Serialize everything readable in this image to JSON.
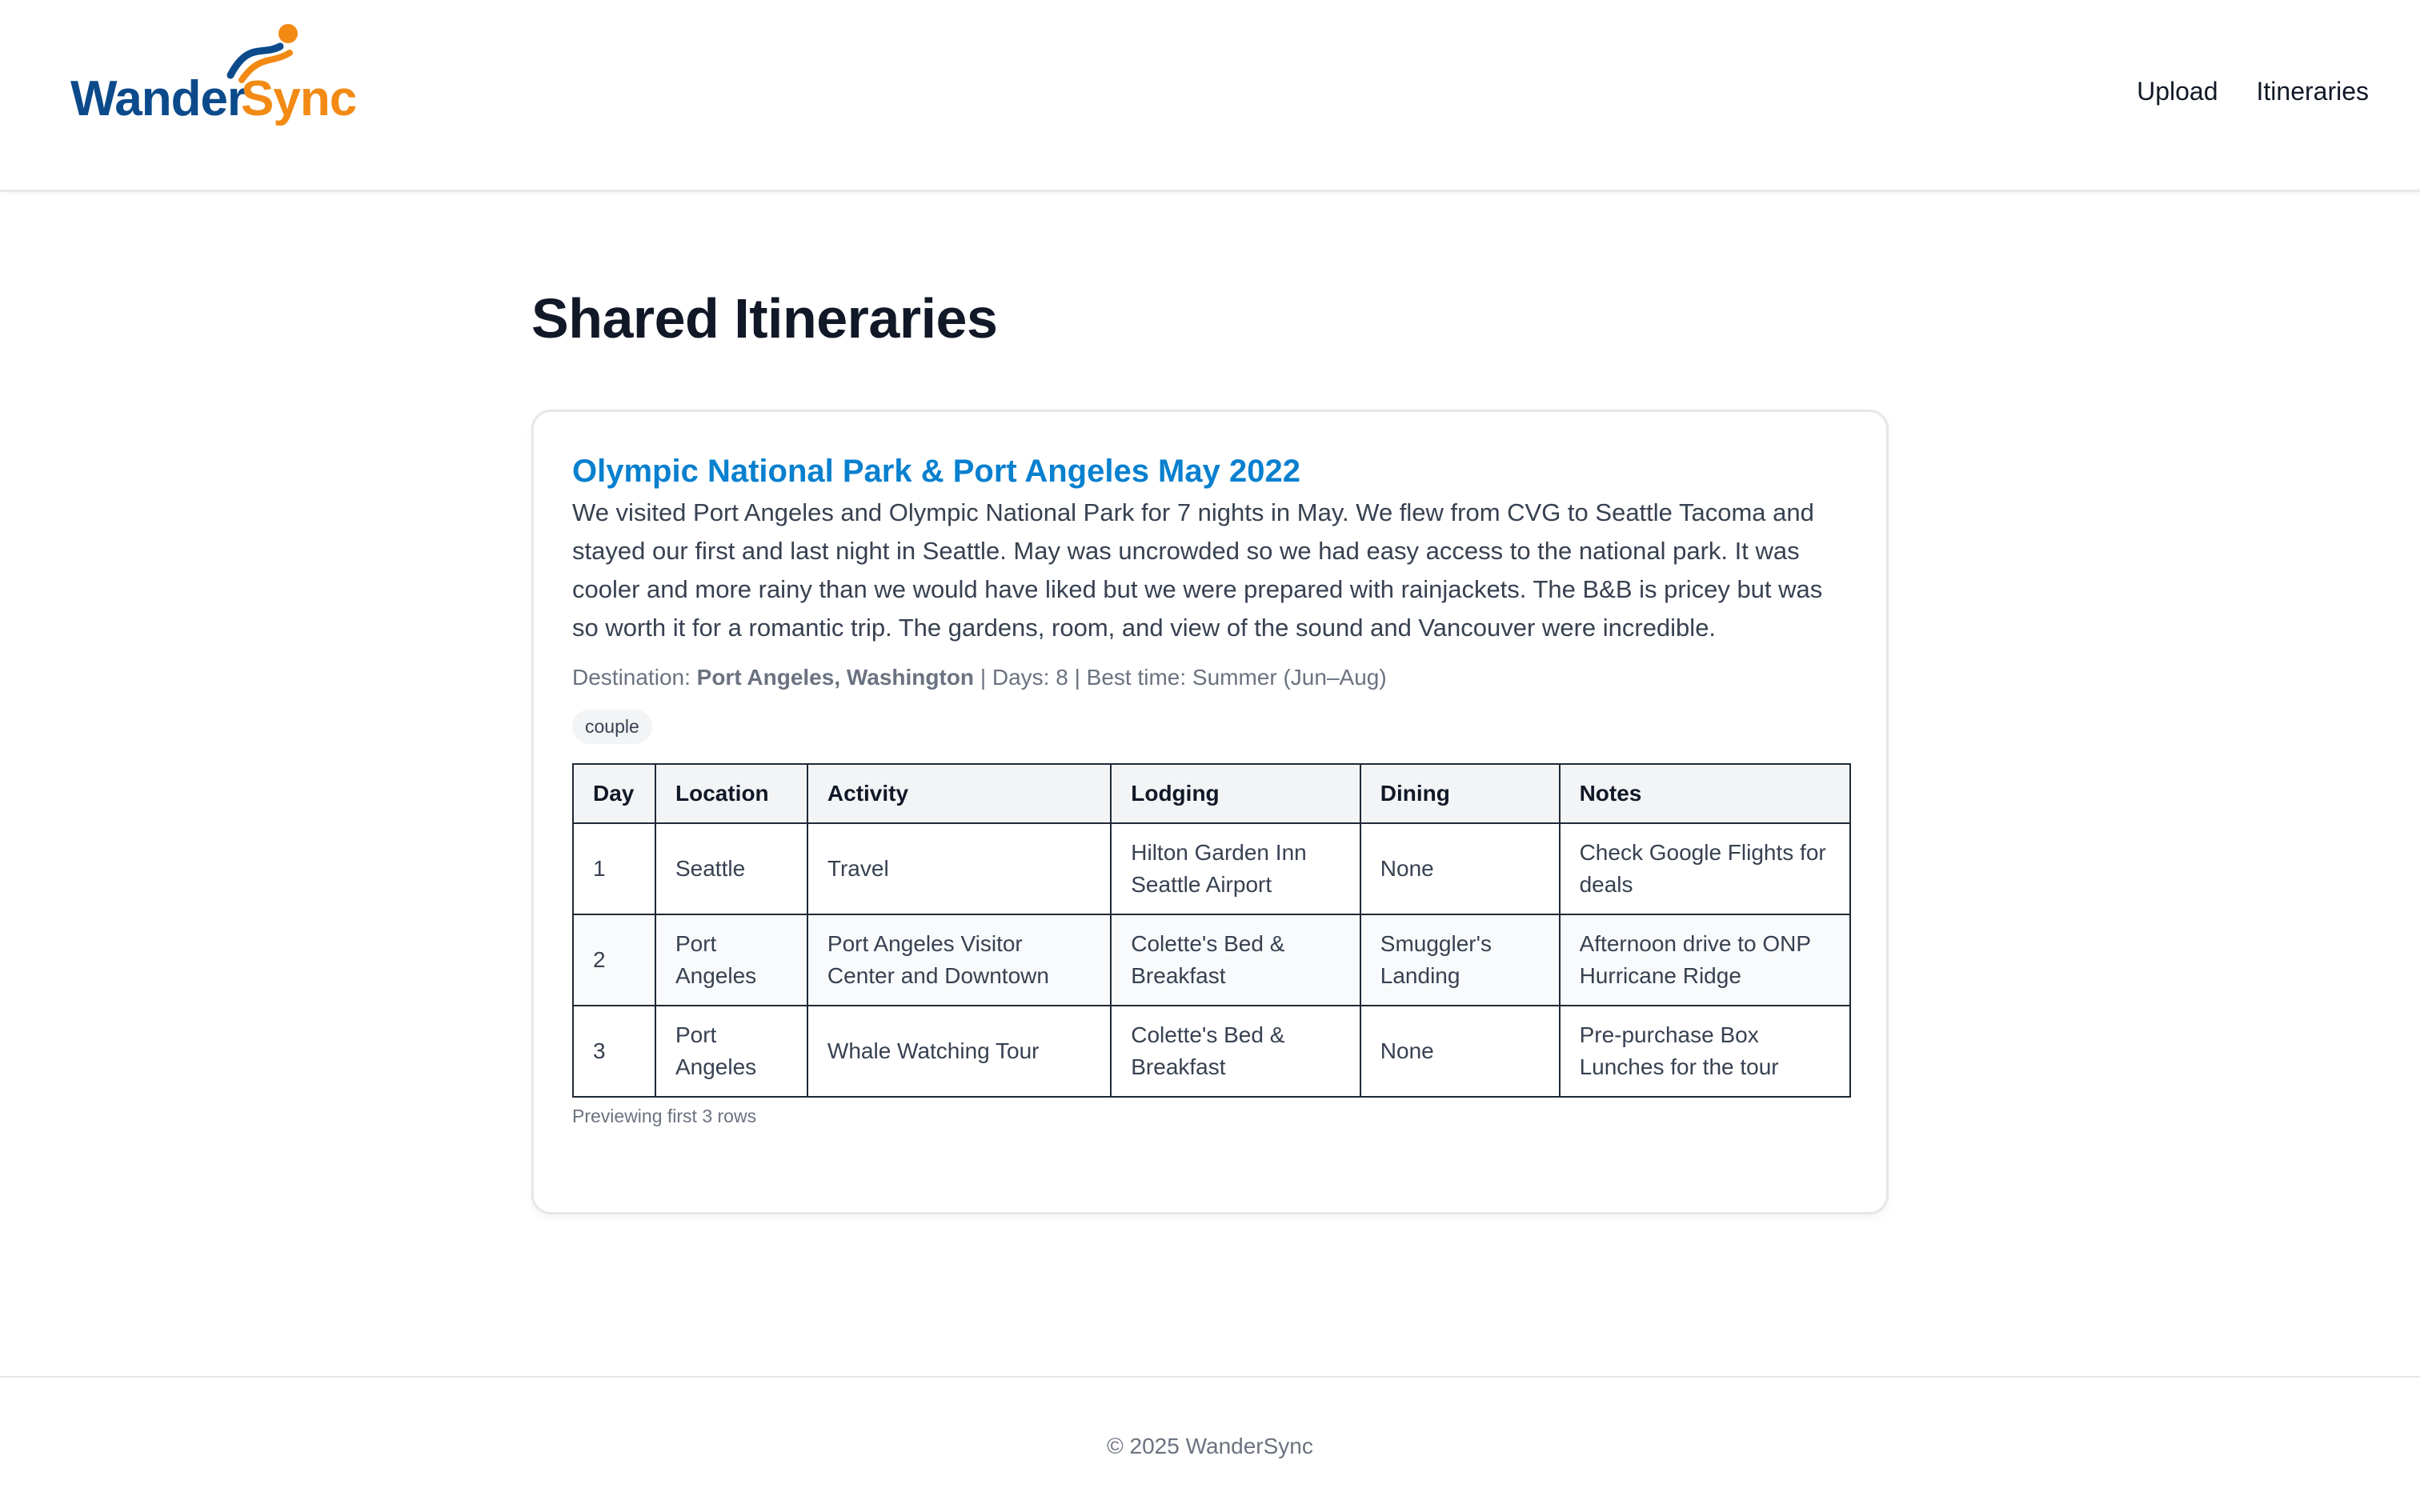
{
  "brand": {
    "name_part1": "Wander",
    "name_part2": "Sync",
    "colors": {
      "primary": "#0b4a8b",
      "accent": "#f28a14",
      "link": "#0880cf"
    }
  },
  "nav": {
    "items": [
      {
        "label": "Upload"
      },
      {
        "label": "Itineraries"
      }
    ]
  },
  "page": {
    "title": "Shared Itineraries"
  },
  "itinerary": {
    "title": "Olympic National Park & Port Angeles May 2022",
    "description": "We visited Port Angeles and Olympic National Park for 7 nights in May. We flew from CVG to Seattle Tacoma and stayed our first and last night in Seattle. May was uncrowded so we had easy access to the national park. It was cooler and more rainy than we would have liked but we were prepared with rainjackets. The B&B is pricey but was so worth it for a romantic trip. The gardens, room, and view of the sound and Vancouver were incredible.",
    "meta": {
      "destination_label": "Destination:",
      "destination": "Port Angeles, Washington",
      "days_text": "| Days: 8 | Best time: Summer (Jun–Aug)"
    },
    "tag": "couple",
    "table": {
      "headers": [
        "Day",
        "Location",
        "Activity",
        "Lodging",
        "Dining",
        "Notes"
      ],
      "rows": [
        [
          "1",
          "Seattle",
          "Travel",
          "Hilton Garden Inn Seattle Airport",
          "None",
          "Check Google Flights for deals"
        ],
        [
          "2",
          "Port Angeles",
          "Port Angeles Visitor Center and Downtown",
          "Colette's Bed & Breakfast",
          "Smuggler's Landing",
          "Afternoon drive to ONP Hurricane Ridge"
        ],
        [
          "3",
          "Port Angeles",
          "Whale Watching Tour",
          "Colette's Bed & Breakfast",
          "None",
          "Pre-purchase Box Lunches for the tour"
        ]
      ]
    },
    "preview_note": "Previewing first 3 rows"
  },
  "footer": {
    "copyright": "© 2025 WanderSync"
  }
}
